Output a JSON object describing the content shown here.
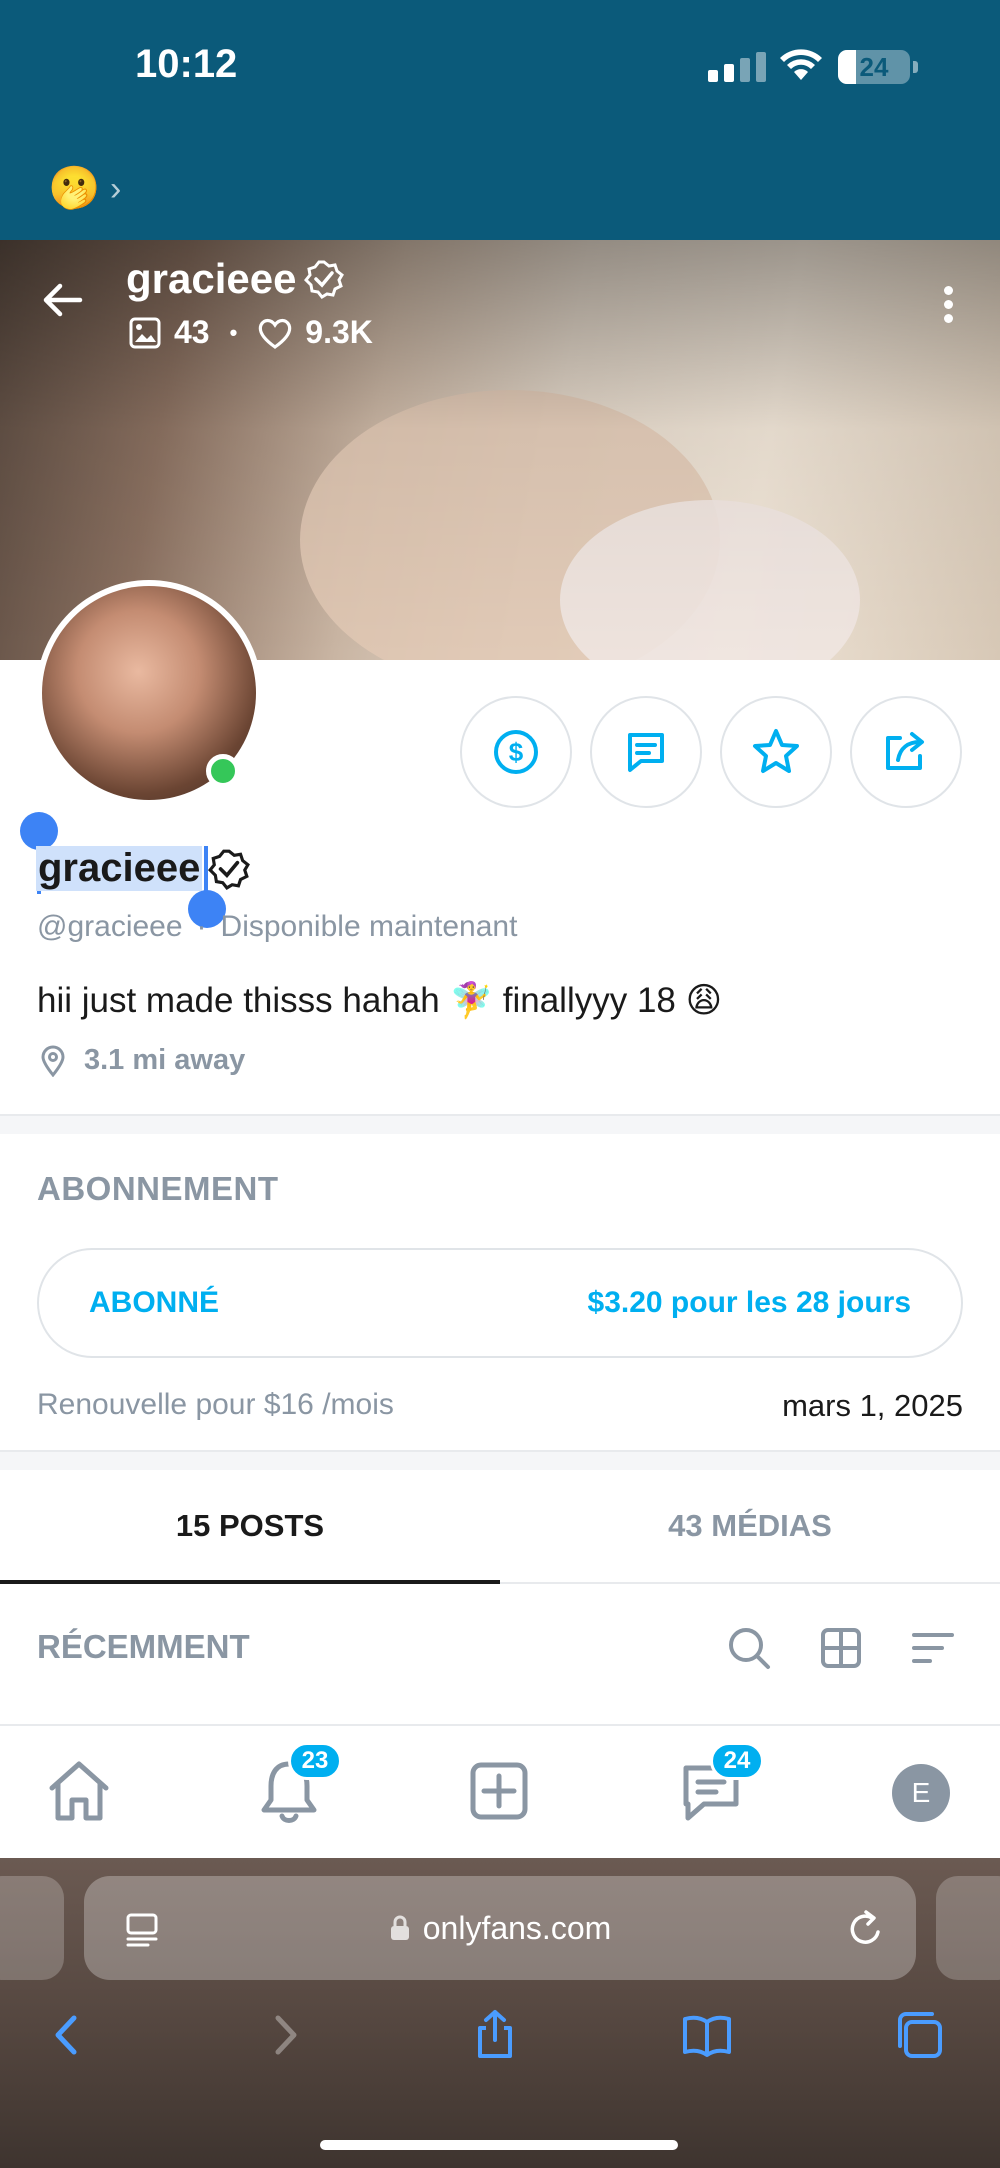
{
  "status": {
    "time": "10:12",
    "battery": "24"
  },
  "header": {
    "emoji": "🫢",
    "chevron": "›"
  },
  "profile": {
    "name": "gracieee",
    "handle": "@gracieee",
    "availability": "Disponible maintenant",
    "photos": "43",
    "likes": "9.3K",
    "bio": "hii just made thisss hahah 🧚‍♀️ finallyyy 18 😩",
    "distance": "3.1 mi away"
  },
  "subscription": {
    "heading": "ABONNEMENT",
    "status": "ABONNÉ",
    "price": "$3.20 pour les 28 jours",
    "renew": "Renouvelle pour $16 /mois",
    "date": "mars 1, 2025"
  },
  "tabs": [
    {
      "label": "15 POSTS",
      "active": true
    },
    {
      "label": "43 MÉDIAS",
      "active": false
    }
  ],
  "feed": {
    "heading": "RÉCEMMENT"
  },
  "bottom_nav": {
    "notifications_badge": "23",
    "messages_badge": "24",
    "avatar_letter": "E"
  },
  "browser": {
    "url": "onlyfans.com"
  },
  "colors": {
    "header": "#0b5a7a",
    "accent": "#00aff0",
    "selection": "#3d83f5",
    "online": "#35c759"
  }
}
